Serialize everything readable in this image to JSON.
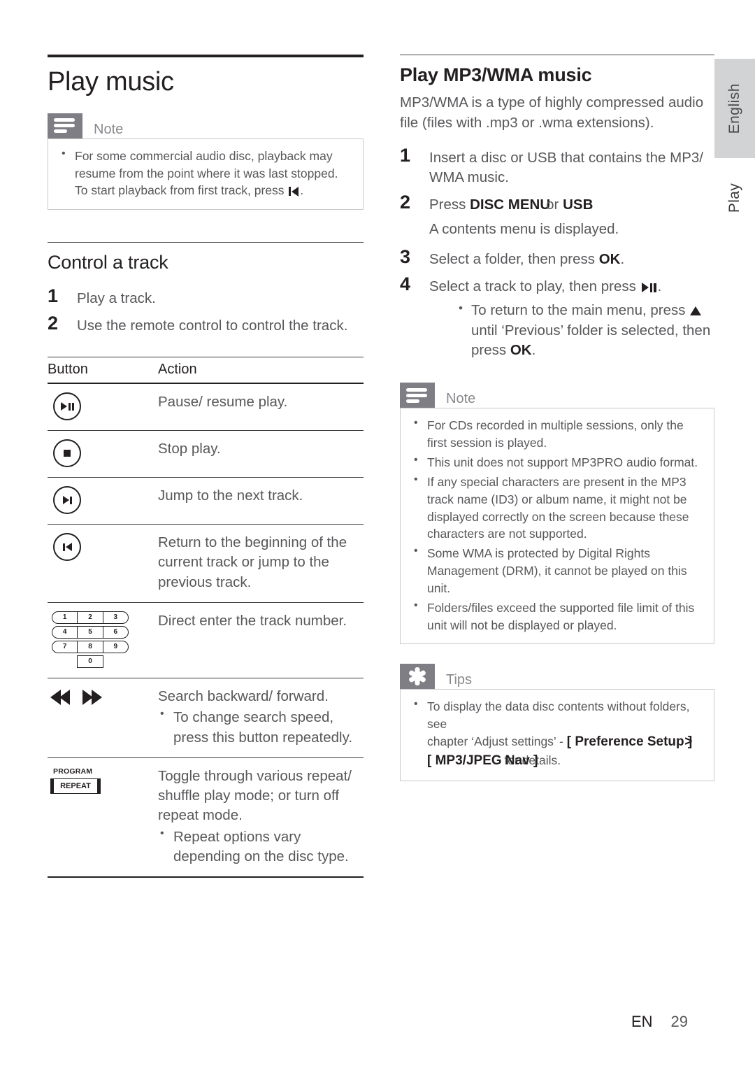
{
  "left": {
    "title": "Play music",
    "note": {
      "icon": "note-icon",
      "label": "Note",
      "bullets": [
        "For some commercial audio disc, playback may resume from the point where it was last stopped. To start playback from first track, press"
      ],
      "bullet_trailing": "."
    },
    "section": {
      "heading": "Control a track",
      "steps": [
        {
          "num": "1",
          "text": "Play a track."
        },
        {
          "num": "2",
          "text": "Use the remote control to control the track."
        }
      ]
    },
    "table": {
      "headers": [
        "Button",
        "Action"
      ],
      "rows": [
        {
          "button_icon": "play-pause-button-icon",
          "action": "Pause/ resume play.",
          "sub": ""
        },
        {
          "button_icon": "stop-button-icon",
          "action": "Stop play.",
          "sub": ""
        },
        {
          "button_icon": "next-track-button-icon",
          "action": "Jump to the next track.",
          "sub": ""
        },
        {
          "button_icon": "previous-track-button-icon",
          "action": "Return to the beginning of the current track or jump to the previous track.",
          "sub": ""
        },
        {
          "button_icon": "numeric-keypad-icon",
          "action": "Direct enter the track number.",
          "sub": ""
        },
        {
          "button_icon": "search-backward-forward-icon",
          "action": "Search backward/ forward.",
          "sub": "To change search speed, press this button repeatedly."
        },
        {
          "button_icon": "program-repeat-button-icon",
          "action": "Toggle through various repeat/ shuffle play mode; or turn off repeat mode.",
          "sub": "Repeat options vary depending on the disc type."
        }
      ],
      "keypad": {
        "rows": [
          [
            "1",
            "2",
            "3"
          ],
          [
            "4",
            "5",
            "6"
          ],
          [
            "7",
            "8",
            "9"
          ]
        ],
        "zero": "0"
      },
      "program_label": "PROGRAM",
      "repeat_label": "REPEAT"
    }
  },
  "right": {
    "title": "Play MP3/WMA music",
    "intro": "MP3/WMA is a type of highly compressed audio file (files with .mp3 or .wma extensions).",
    "steps": [
      {
        "num": "1",
        "text": "Insert a disc or USB that contains the MP3/ WMA music."
      },
      {
        "num": "2",
        "text_prefix": "Press ",
        "bold1": "DISC MENU",
        "mid": "or",
        "bold2": "USB",
        "substep": "A contents menu is displayed."
      },
      {
        "num": "3",
        "text_prefix": "Select a folder, then press ",
        "bold1": "OK",
        "suffix": "."
      },
      {
        "num": "4",
        "text_prefix": "Select a track to play, then press ",
        "suffix": ".",
        "bullet_prefix": "To return to the main menu, press ",
        "bullet_mid": " until ‘Previous’ folder is selected, then press ",
        "bullet_bold": "OK",
        "bullet_suffix": "."
      }
    ],
    "note": {
      "icon": "note-icon",
      "label": "Note",
      "bullets": [
        "For CDs recorded in multiple sessions, only the first session is played.",
        "This unit does not support MP3PRO audio format.",
        "If any special characters are present in the MP3 track name (ID3) or album name, it might not be displayed correctly on the screen because these characters are not supported.",
        "Some WMA is protected by Digital Rights Management (DRM), it cannot be played on this unit.",
        "Folders/files exceed the supported file limit of this unit will not be displayed or played."
      ]
    },
    "tips": {
      "icon": "asterisk-icon",
      "label": "Tips",
      "bullet_line1": "To display the data disc contents without folders, see",
      "bullet_line2_prefix": "chapter ‘Adjust settings’ - ",
      "bullet_line2_bold": "[ Preference Setup ]",
      "bullet_line2_tail": ">",
      "bullet_line3_bold": "[ MP3/JPEG Nav ]",
      "bullet_line3_tail": "for details."
    }
  },
  "sidebar": {
    "language_tab": "English",
    "chapter_label": "Play"
  },
  "footer": {
    "lang_code": "EN",
    "page_number": "29"
  },
  "colors": {
    "ink": "#231f20",
    "body_text": "#58585b",
    "badge_gray": "#7e7e84",
    "tab_gray": "#d2d3d5",
    "rule": "#3b3b3d"
  }
}
